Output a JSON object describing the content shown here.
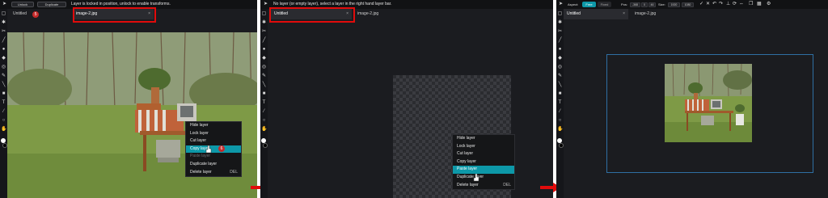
{
  "panel1": {
    "buttons": {
      "unlock": "Unlock",
      "duplicate": "Duplicate"
    },
    "status": "Layer is locked in position, unlock to enable transforms.",
    "tabs": [
      {
        "label": "Untitled",
        "close": ""
      },
      {
        "label": "image-2.jpg",
        "close": "×"
      }
    ],
    "badge_tab": "5",
    "badge_menu": "6",
    "context_menu": [
      {
        "label": "Hide layer",
        "shortcut": ""
      },
      {
        "label": "Lock layer",
        "shortcut": ""
      },
      {
        "label": "Cut layer",
        "shortcut": ""
      },
      {
        "label": "Copy layer",
        "shortcut": ""
      },
      {
        "label": "Paste layer",
        "shortcut": ""
      },
      {
        "label": "Duplicate layer",
        "shortcut": ""
      },
      {
        "label": "Delete layer",
        "shortcut": "DEL"
      }
    ],
    "active_item": "Copy layer"
  },
  "panel2": {
    "status": "No layer (or empty layer), select a layer in the right hand layer bar.",
    "tabs": [
      {
        "label": "Untitled",
        "close": "×"
      },
      {
        "label": "image-2.jpg",
        "close": ""
      }
    ],
    "context_menu": [
      {
        "label": "Hide layer",
        "shortcut": ""
      },
      {
        "label": "Lock layer",
        "shortcut": ""
      },
      {
        "label": "Cut layer",
        "shortcut": ""
      },
      {
        "label": "Copy layer",
        "shortcut": ""
      },
      {
        "label": "Paste layer",
        "shortcut": ""
      },
      {
        "label": "Duplicate layer",
        "shortcut": ""
      },
      {
        "label": "Delete layer",
        "shortcut": "DEL"
      }
    ],
    "active_item": "Paste layer"
  },
  "panel3": {
    "options": {
      "aspect_label": "Aspect:",
      "free": "Free",
      "fixed": "Fixed",
      "pos_label": "Pos:",
      "pos_x": "-368",
      "pos_y": "0",
      "pos_w": "46",
      "size_label": "Size:",
      "size_w": "1920",
      "size_h": "1080"
    },
    "tabs": [
      {
        "label": "Untitled",
        "close": "×"
      },
      {
        "label": "image-2.jpg",
        "close": ""
      }
    ]
  },
  "colors": {
    "highlight": "#e10b0b",
    "accent": "#0d98a8",
    "arrow": "#e10b0b",
    "bg": "#1b1c20"
  },
  "icons": [
    "cursor-icon",
    "marquee-icon",
    "lasso-icon",
    "crop-icon",
    "brush-icon",
    "eraser-icon",
    "fill-icon",
    "eyedropper-icon",
    "text-icon",
    "shape-icon",
    "hand-icon",
    "zoom-icon"
  ]
}
